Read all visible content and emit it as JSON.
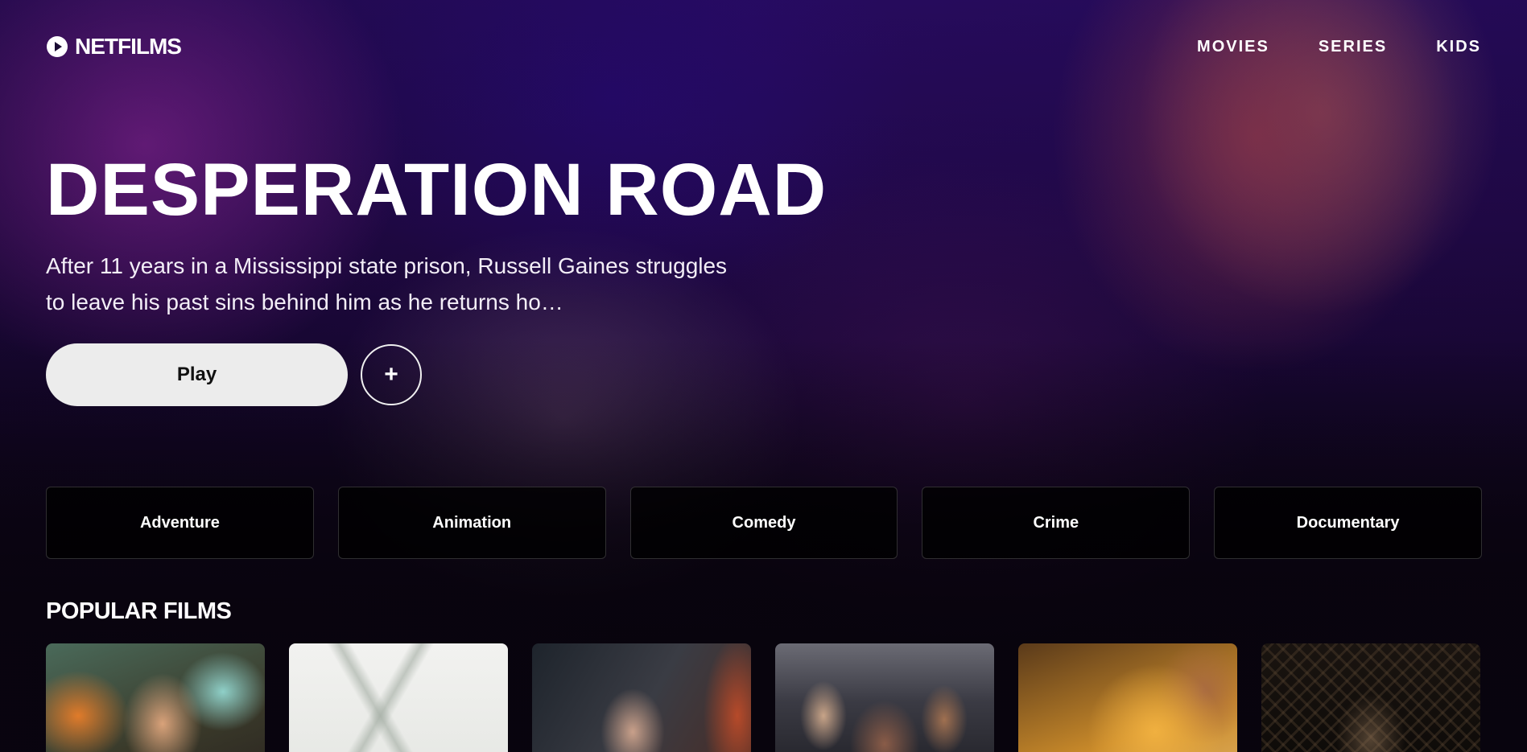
{
  "app": {
    "logo_text": "NETFILMS",
    "logo_icon": "play-circle-icon"
  },
  "nav": {
    "items": [
      {
        "label": "MOVIES"
      },
      {
        "label": "SERIES"
      },
      {
        "label": "KIDS"
      }
    ]
  },
  "hero": {
    "title": "DESPERATION ROAD",
    "description": "After 11 years in a Mississippi state prison, Russell Gaines struggles to leave his past sins behind him as he returns ho…",
    "play_label": "Play",
    "add_label": "+"
  },
  "genres": [
    {
      "label": "Adventure"
    },
    {
      "label": "Animation"
    },
    {
      "label": "Comedy"
    },
    {
      "label": "Crime"
    },
    {
      "label": "Documentary"
    }
  ],
  "popular": {
    "title": "POPULAR FILMS"
  },
  "colors": {
    "background": "#07040c",
    "play_button": "#ececec",
    "text": "#ffffff"
  }
}
